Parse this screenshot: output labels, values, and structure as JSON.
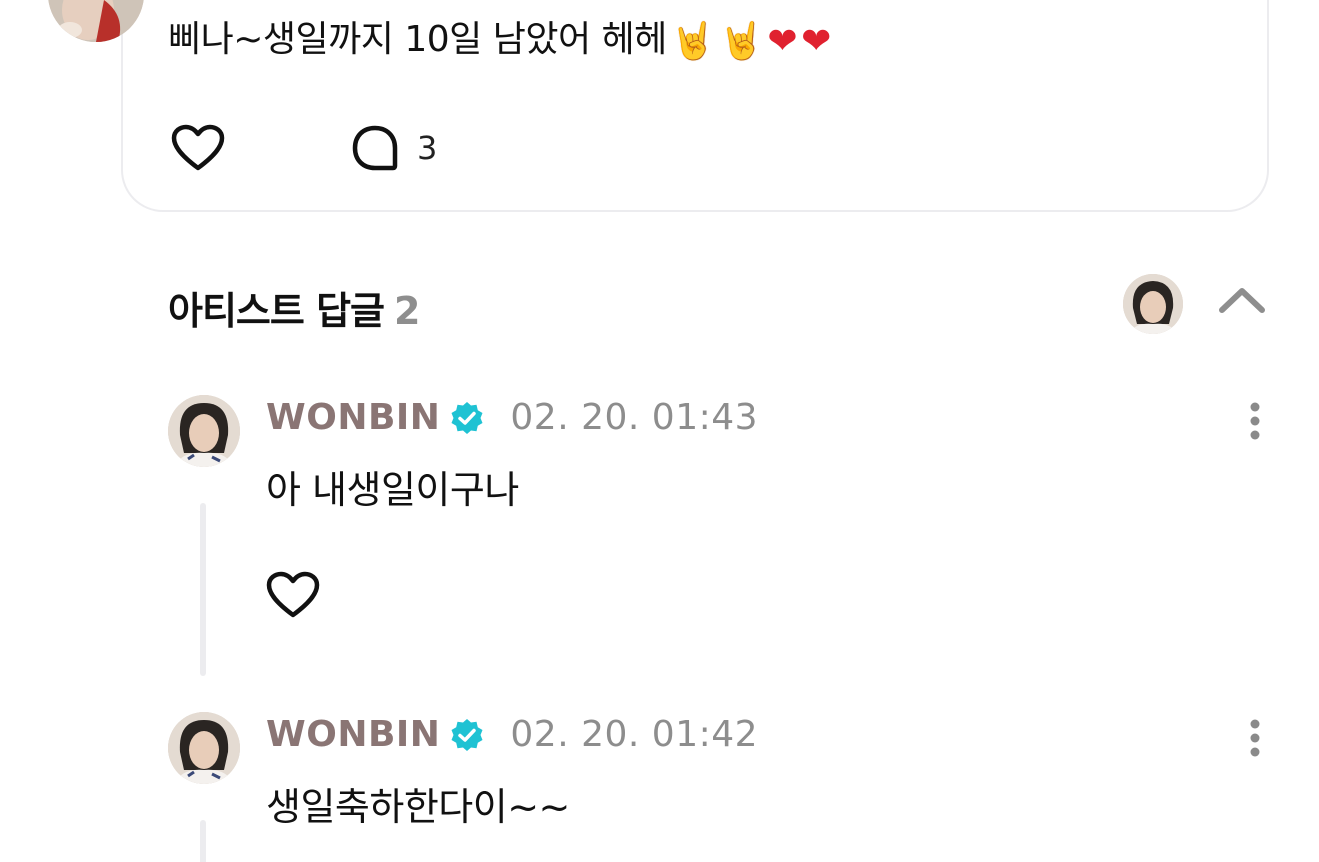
{
  "post": {
    "text": "삐나~생일까지 10일 남았어 헤헤",
    "emojis": [
      "🤘",
      "🤘",
      "❤",
      "❤"
    ],
    "comment_count": "3",
    "icons": [
      "heart-outline-icon",
      "comment-bubble-icon"
    ]
  },
  "artist_replies": {
    "title": "아티스트 답글",
    "count": "2",
    "icons": [
      "chevron-up-icon"
    ]
  },
  "replies": [
    {
      "author": "WONBIN",
      "timestamp": "02. 20. 01:43",
      "text": "아 내생일이구나",
      "icons": [
        "verified-badge-icon",
        "more-vertical-icon",
        "heart-outline-icon"
      ]
    },
    {
      "author": "WONBIN",
      "timestamp": "02. 20. 01:42",
      "text": "생일축하한다이~~",
      "icons": [
        "verified-badge-icon",
        "more-vertical-icon"
      ]
    }
  ],
  "colors": {
    "author": "#8a7574",
    "timestamp": "#8d8d8d",
    "verified": "#1fc2d3",
    "count_gray": "#8e8e8e",
    "divider": "#ececef",
    "heart_red": "#e0212f"
  }
}
